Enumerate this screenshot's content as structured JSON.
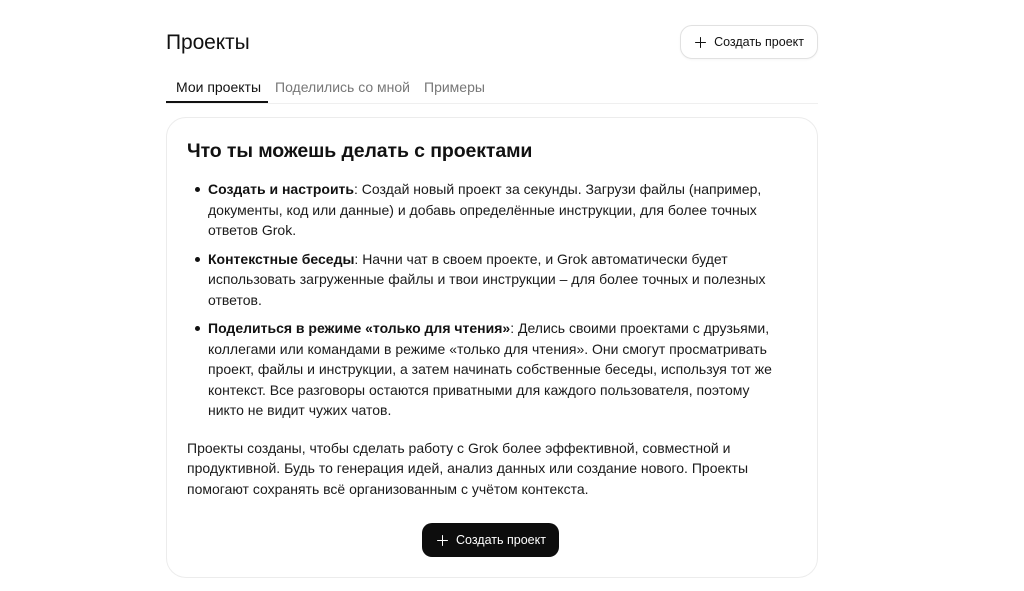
{
  "header": {
    "title": "Проекты",
    "create_button_label": "Создать проект",
    "create_button_icon": "plus-icon"
  },
  "tabs": [
    {
      "label": "Мои проекты",
      "active": true
    },
    {
      "label": "Поделились со мной",
      "active": false
    },
    {
      "label": "Примеры",
      "active": false
    }
  ],
  "info_card": {
    "title": "Что ты можешь делать с проектами",
    "features": [
      {
        "heading": "Создать и настроить",
        "text": ": Создай новый проект за секунды. Загрузи файлы (например, документы, код или данные) и добавь определённые инструкции, для более точных ответов Grok."
      },
      {
        "heading": "Контекстные беседы",
        "text": ": Начни чат в своем проекте, и Grok автоматически будет использовать загруженные файлы и твои инструкции – для более точных и полезных ответов."
      },
      {
        "heading": "Поделиться в режиме «только для чтения»",
        "text": ": Делись своими проектами с друзьями, коллегами или командами в режиме «только для чтения». Они смогут просматривать проект, файлы и инструкции, а затем начинать собственные беседы, используя тот же контекст. Все разговоры остаются приватными для каждого пользователя, поэтому никто не видит чужих чатов."
      }
    ],
    "summary": "Проекты созданы, чтобы сделать работу с Grok более эффективной, совместной и продуктивной. Будь то генерация идей, анализ данных или создание нового. Проекты помогают сохранять всё организованным с учётом контекста.",
    "create_button_label": "Создать проект",
    "create_button_icon": "plus-icon"
  },
  "colors": {
    "primary_button_bg": "#0d0d0d",
    "primary_button_text": "#ffffff",
    "tab_inactive": "#777777",
    "text": "#111111",
    "border": "#ececec"
  }
}
